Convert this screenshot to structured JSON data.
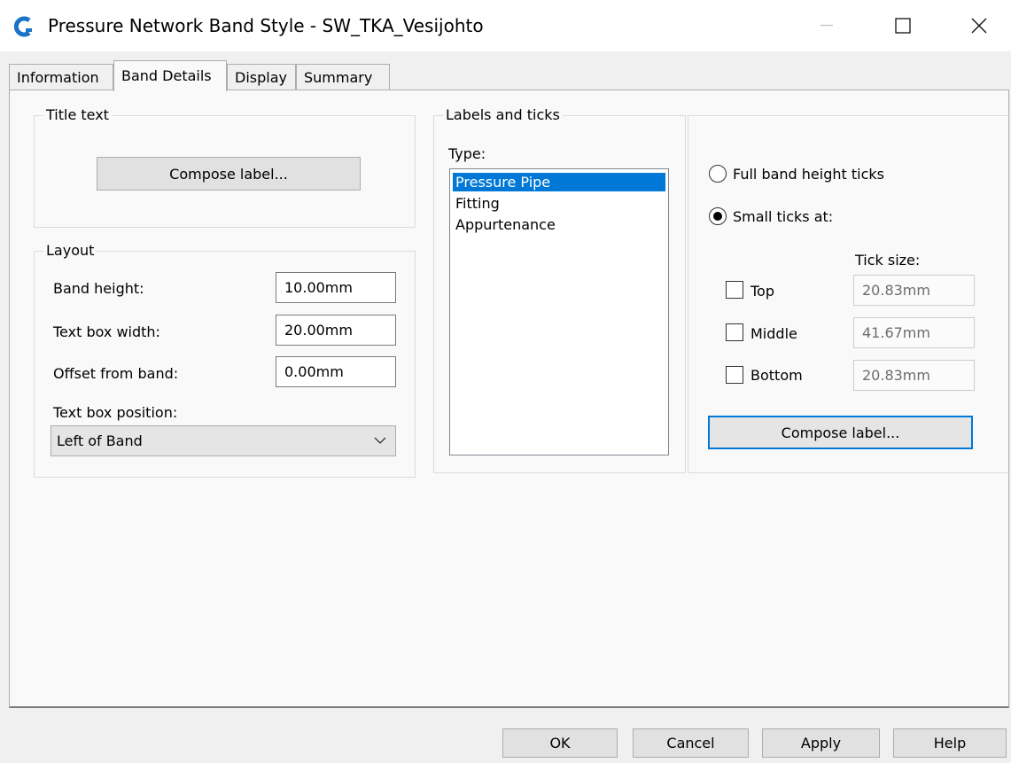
{
  "window": {
    "title": "Pressure Network Band Style - SW_TKA_Vesijohto",
    "app_icon": "civil3d-c-icon",
    "brand_color": "#1a73c7"
  },
  "tabs": [
    {
      "label": "Information"
    },
    {
      "label": "Band Details"
    },
    {
      "label": "Display"
    },
    {
      "label": "Summary"
    }
  ],
  "active_tab": "Band Details",
  "title_text": {
    "group_label": "Title text",
    "compose_label": "Compose label..."
  },
  "layout": {
    "group_label": "Layout",
    "band_height": {
      "label": "Band height:",
      "value": "10.00mm"
    },
    "text_box_width": {
      "label": "Text box width:",
      "value": "20.00mm"
    },
    "offset_from_band": {
      "label": "Offset from band:",
      "value": "0.00mm"
    },
    "text_box_position": {
      "label": "Text box position:",
      "value": "Left of Band"
    }
  },
  "labels_ticks": {
    "group_label": "Labels and ticks",
    "type_label": "Type:",
    "types": [
      "Pressure Pipe",
      "Fitting",
      "Appurtenance"
    ],
    "selected_type": "Pressure Pipe",
    "full_band_ticks": {
      "label": "Full band height ticks",
      "checked": false
    },
    "small_ticks": {
      "label": "Small ticks at:",
      "checked": true
    },
    "tick_size_label": "Tick size:",
    "top": {
      "label": "Top",
      "checked": false,
      "value": "20.83mm"
    },
    "middle": {
      "label": "Middle",
      "checked": false,
      "value": "41.67mm"
    },
    "bottom": {
      "label": "Bottom",
      "checked": false,
      "value": "20.83mm"
    },
    "compose_label": "Compose label..."
  },
  "footer": {
    "ok": "OK",
    "cancel": "Cancel",
    "apply": "Apply",
    "help": "Help"
  },
  "colors": {
    "selection": "#0078d7",
    "focus": "#0078d7"
  }
}
